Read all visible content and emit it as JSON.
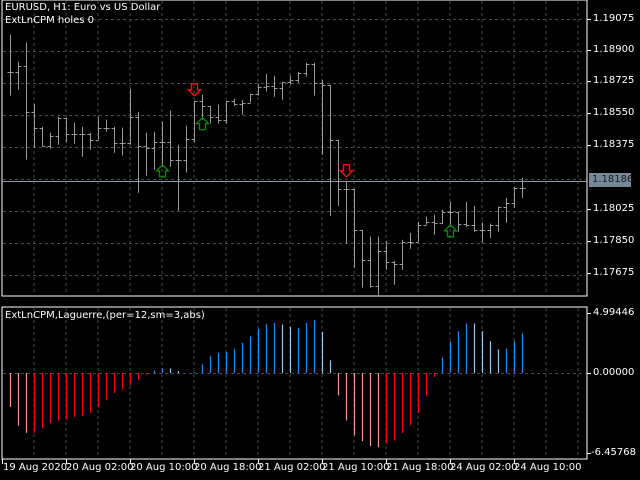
{
  "header": {
    "title": "EURUSD, H1:  Euro vs US Dollar",
    "indicator_status": "ExtLnCPM holes 0"
  },
  "indicator_pane": {
    "title": "ExtLnCPM,Laguerre,(per=12,sm=3,abs)",
    "scale_labels": [
      "4.99446",
      "0.00000",
      "-6.45768"
    ]
  },
  "price_axis": {
    "labels": [
      "1.19075",
      "1.18900",
      "1.18725",
      "1.18550",
      "1.18375",
      "1.18025",
      "1.17850",
      "1.17675"
    ],
    "current_price": "1.18186"
  },
  "time_axis": {
    "labels": [
      "19 Aug 2020",
      "20 Aug 02:00",
      "20 Aug 10:00",
      "20 Aug 18:00",
      "21 Aug 02:00",
      "21 Aug 10:00",
      "21 Aug 18:00",
      "24 Aug 02:00",
      "24 Aug 10:00"
    ]
  },
  "colors": {
    "background": "#000000",
    "bars": "#9a9a9a",
    "grid": "#4a4a4a",
    "current_price_line": "#8a9ab0",
    "hist_red": "#ff0000",
    "hist_light_red": "#ffa07a",
    "hist_blue": "#1e90ff",
    "hist_light_blue": "#87cefa",
    "arrow_up": "#0a8a0a",
    "arrow_down": "#ff1010"
  },
  "chart_data": [
    {
      "type": "ohlc",
      "symbol": "EURUSD",
      "timeframe": "H1",
      "ylim": [
        1.1753,
        1.1912
      ],
      "current_price": 1.18186,
      "ohlc": [
        [
          1.18785,
          1.18987,
          1.18654,
          1.18785
        ],
        [
          1.18785,
          1.1884,
          1.18687,
          1.18818
        ],
        [
          1.18818,
          1.18944,
          1.18304,
          1.18566
        ],
        [
          1.18566,
          1.1861,
          1.18369,
          1.18479
        ],
        [
          1.18479,
          1.18484,
          1.18375,
          1.1838
        ],
        [
          1.1838,
          1.18451,
          1.18364,
          1.18435
        ],
        [
          1.18435,
          1.18539,
          1.18386,
          1.18533
        ],
        [
          1.18533,
          1.18523,
          1.18397,
          1.18446
        ],
        [
          1.18446,
          1.18506,
          1.18391,
          1.18446
        ],
        [
          1.18446,
          1.18484,
          1.1832,
          1.18446
        ],
        [
          1.18446,
          1.18451,
          1.18358,
          1.18413
        ],
        [
          1.18413,
          1.18539,
          1.1843,
          1.18479
        ],
        [
          1.18479,
          1.18523,
          1.18457,
          1.18479
        ],
        [
          1.18479,
          1.18484,
          1.18342,
          1.18397
        ],
        [
          1.18397,
          1.18479,
          1.18326,
          1.18397
        ],
        [
          1.18397,
          1.18692,
          1.18386,
          1.18539
        ],
        [
          1.18539,
          1.18566,
          1.18123,
          1.1838
        ],
        [
          1.1838,
          1.18451,
          1.18216,
          1.18369
        ],
        [
          1.18369,
          1.18457,
          1.18249,
          1.18402
        ],
        [
          1.18402,
          1.18512,
          1.18265,
          1.18402
        ],
        [
          1.18402,
          1.18572,
          1.18265,
          1.18304
        ],
        [
          1.18304,
          1.18386,
          1.18025,
          1.18304
        ],
        [
          1.18304,
          1.1849,
          1.18233,
          1.18419
        ],
        [
          1.18419,
          1.18626,
          1.18397,
          1.18626
        ],
        [
          1.18626,
          1.18659,
          1.18523,
          1.18599
        ],
        [
          1.18599,
          1.18594,
          1.18501,
          1.18539
        ],
        [
          1.18539,
          1.18605,
          1.18501,
          1.18523
        ],
        [
          1.18523,
          1.18626,
          1.18501,
          1.18626
        ],
        [
          1.18626,
          1.18637,
          1.18599,
          1.1861
        ],
        [
          1.1861,
          1.18632,
          1.1855,
          1.18616
        ],
        [
          1.18616,
          1.18665,
          1.18616,
          1.18665
        ],
        [
          1.18665,
          1.18719,
          1.18654,
          1.18703
        ],
        [
          1.18703,
          1.18774,
          1.18676,
          1.18709
        ],
        [
          1.18709,
          1.18763,
          1.18648,
          1.18698
        ],
        [
          1.18698,
          1.1873,
          1.18632,
          1.1873
        ],
        [
          1.1873,
          1.18763,
          1.18714,
          1.18741
        ],
        [
          1.18741,
          1.18785,
          1.18725,
          1.1878
        ],
        [
          1.1878,
          1.18834,
          1.18758,
          1.18829
        ],
        [
          1.18829,
          1.18834,
          1.18654,
          1.18725
        ],
        [
          1.18725,
          1.18741,
          1.18331,
          1.18714
        ],
        [
          1.18714,
          1.18413,
          1.17997,
          1.18413
        ],
        [
          1.18413,
          1.18189,
          1.18052,
          1.18145
        ],
        [
          1.18145,
          1.18183,
          1.17844,
          1.18145
        ],
        [
          1.18145,
          1.1803,
          1.17713,
          1.17921
        ],
        [
          1.17921,
          1.17904,
          1.17604,
          1.17757
        ],
        [
          1.17757,
          1.17883,
          1.17604,
          1.17615
        ],
        [
          1.17615,
          1.17883,
          1.17554,
          1.17806
        ],
        [
          1.17806,
          1.17861,
          1.17702,
          1.17746
        ],
        [
          1.17746,
          1.17751,
          1.1762,
          1.17735
        ],
        [
          1.17735,
          1.17866,
          1.17702,
          1.17855
        ],
        [
          1.17855,
          1.17904,
          1.17817,
          1.17855
        ],
        [
          1.17855,
          1.17965,
          1.17861,
          1.17948
        ],
        [
          1.17948,
          1.17992,
          1.17948,
          1.17965
        ],
        [
          1.17965,
          1.18003,
          1.17893,
          1.17959
        ],
        [
          1.17959,
          1.1803,
          1.17954,
          1.18019
        ],
        [
          1.18019,
          1.18074,
          1.17937,
          1.18019
        ],
        [
          1.18019,
          1.18003,
          1.1791,
          1.17954
        ],
        [
          1.17954,
          1.18074,
          1.17937,
          1.17948
        ],
        [
          1.17948,
          1.18052,
          1.1791,
          1.17921
        ],
        [
          1.17921,
          1.17959,
          1.1785,
          1.17921
        ],
        [
          1.17921,
          1.17954,
          1.17877,
          1.17948
        ],
        [
          1.17948,
          1.18047,
          1.1791,
          1.18047
        ],
        [
          1.18047,
          1.18096,
          1.17959,
          1.18068
        ],
        [
          1.18068,
          1.18156,
          1.18041,
          1.1815
        ],
        [
          1.1815,
          1.18205,
          1.18096,
          1.1815
        ]
      ],
      "signals": [
        {
          "bar": 19,
          "type": "up"
        },
        {
          "bar": 23,
          "type": "down"
        },
        {
          "bar": 24,
          "type": "up"
        },
        {
          "bar": 42,
          "type": "down"
        },
        {
          "bar": 55,
          "type": "up"
        }
      ]
    },
    {
      "type": "bar",
      "title": "ExtLnCPM,Laguerre,(per=12,sm=3,abs)",
      "ylim": [
        -6.45768,
        4.99446
      ],
      "values": [
        -2.78,
        -4.3,
        -4.9,
        -4.9,
        -4.5,
        -4.1,
        -3.9,
        -3.77,
        -3.6,
        -3.5,
        -3.28,
        -2.79,
        -2.18,
        -1.64,
        -1.36,
        -1.0,
        -0.55,
        -0.16,
        0.22,
        0.38,
        0.38,
        0.16,
        0,
        0.08,
        0.71,
        1.37,
        1.64,
        1.72,
        1.97,
        2.46,
        3.0,
        3.6,
        3.99,
        4.1,
        3.97,
        3.77,
        3.69,
        4.1,
        4.32,
        3.36,
        1.04,
        -1.83,
        -3.88,
        -5.1,
        -5.57,
        -5.98,
        -6.07,
        -5.74,
        -5.52,
        -4.92,
        -4.29,
        -3.28,
        -1.83,
        -0.33,
        1.26,
        2.57,
        3.42,
        4.05,
        4.05,
        3.42,
        2.6,
        1.94,
        2.0,
        2.6,
        3.25
      ],
      "color_classes": [
        "lr",
        "lr",
        "lr",
        "r",
        "r",
        "r",
        "r",
        "r",
        "r",
        "r",
        "r",
        "r",
        "r",
        "r",
        "r",
        "r",
        "r",
        "r",
        "b",
        "b",
        "lb",
        "lb",
        "b",
        "b",
        "b",
        "b",
        "b",
        "b",
        "b",
        "b",
        "b",
        "b",
        "b",
        "b",
        "lb",
        "lb",
        "b",
        "b",
        "b",
        "lb",
        "lb",
        "lr",
        "lr",
        "lr",
        "lr",
        "lr",
        "lr",
        "r",
        "r",
        "r",
        "r",
        "r",
        "r",
        "r",
        "b",
        "b",
        "b",
        "b",
        "lb",
        "lb",
        "lb",
        "lb",
        "b",
        "b",
        "b"
      ]
    }
  ]
}
